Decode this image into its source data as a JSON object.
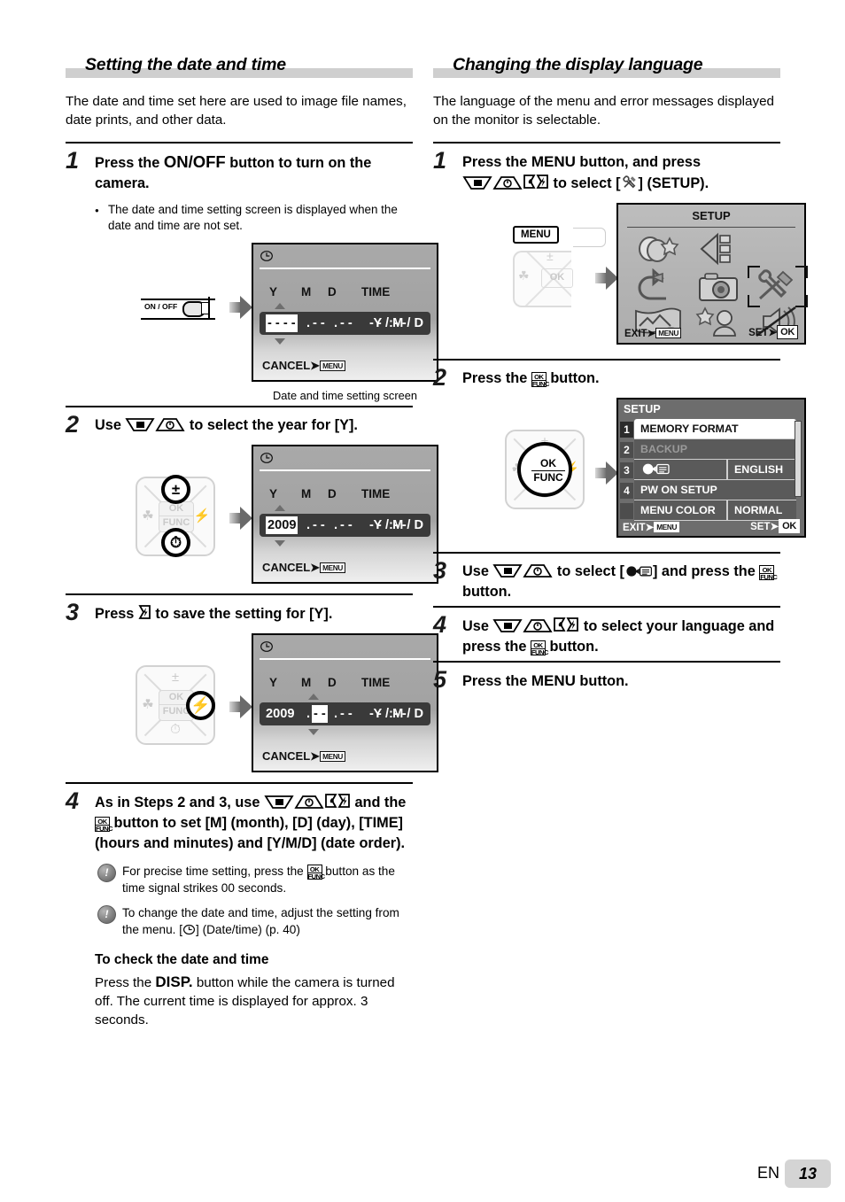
{
  "page": {
    "lang_code": "EN",
    "number": "13"
  },
  "left": {
    "heading": "Setting the date and time",
    "intro": "The date and time set here are used to image file names, date prints, and other data.",
    "step1": {
      "num": "1",
      "head_a": "Press the ",
      "head_btn": "ON/OFF",
      "head_b": " button to turn on the camera.",
      "bullet": "The date and time setting screen is displayed when the date and time are not set.",
      "caption": "Date and time setting screen"
    },
    "step2": {
      "num": "2",
      "head_a": "Use ",
      "head_b": " to select the year for [Y]."
    },
    "step3": {
      "num": "3",
      "head_a": "Press ",
      "head_b": " to save the setting for [Y]."
    },
    "step4": {
      "num": "4",
      "head_a": "As in Steps 2 and 3, use ",
      "head_b": " and the ",
      "head_c": " button to set [M] (month), [D] (day), [TIME] (hours and minutes) and [Y/M/D] (date order).",
      "note1_a": "For precise time setting, press the ",
      "note1_b": " button as the time signal strikes 00 seconds.",
      "note2_a": "To change the date and time, adjust the setting from the menu. [",
      "note2_b": "] (Date/time) (p. 40)",
      "note_icon": "!"
    },
    "check": {
      "heading": "To check the date and time",
      "text_a": "Press the ",
      "btn": "DISP.",
      "text_b": " button while the camera is turned off. The current time is displayed for approx. 3 seconds."
    },
    "lcd1": {
      "clock_icon": "clock-icon",
      "headers": [
        "Y",
        "M",
        "D",
        "TIME"
      ],
      "year": "- - - -",
      "month": "- -",
      "day": "- -",
      "hour": "- -",
      "minute": "- -",
      "order": "Y / M / D",
      "cancel_label": "CANCEL",
      "cancel_key": "MENU",
      "selected_field": "year"
    },
    "lcd2": {
      "headers": [
        "Y",
        "M",
        "D",
        "TIME"
      ],
      "year": "2009",
      "month": "- -",
      "day": "- -",
      "hour": "- -",
      "minute": "- -",
      "order": "Y / M / D",
      "cancel_label": "CANCEL",
      "cancel_key": "MENU",
      "selected_field": "year"
    },
    "lcd3": {
      "headers": [
        "Y",
        "M",
        "D",
        "TIME"
      ],
      "year": "2009",
      "month": "- -",
      "day": "- -",
      "hour": "- -",
      "minute": "- -",
      "order": "Y / M / D",
      "cancel_label": "CANCEL",
      "cancel_key": "MENU",
      "selected_field": "month"
    },
    "onoff_art": {
      "label": "ON / OFF"
    }
  },
  "right": {
    "heading": "Changing the display language",
    "intro": "The language of the menu and error messages displayed on the monitor is selectable.",
    "step1": {
      "num": "1",
      "head_a": "Press the ",
      "head_menu": "MENU",
      "head_b": " button, and press ",
      "head_c": " to select [",
      "head_d": "] (SETUP).",
      "menu_button_label": "MENU"
    },
    "step2": {
      "num": "2",
      "head_a": "Press the ",
      "head_b": " button.",
      "pad_center_top": "OK",
      "pad_center_bottom": "FUNC"
    },
    "step3": {
      "num": "3",
      "head_a": "Use ",
      "head_b": " to select [",
      "head_c": "] and press the ",
      "head_d": " button."
    },
    "step4": {
      "num": "4",
      "head_a": "Use ",
      "head_b": " to select your language and press the ",
      "head_c": " button."
    },
    "step5": {
      "num": "5",
      "head_a": "Press the ",
      "head_menu": "MENU",
      "head_b": " button."
    },
    "setup_grid": {
      "title": "SETUP",
      "exit_label": "EXIT",
      "exit_key": "MENU",
      "set_label": "SET",
      "set_key": "OK",
      "icons": [
        "magic-filter-icon",
        "playback-slideshow-icon",
        "rotate-icon",
        "camera-icon",
        "wrench-tools-setup-icon",
        "panorama-icon",
        "beauty-icon",
        "silent-mute-icon"
      ],
      "selected_icon": "wrench-tools-setup-icon"
    },
    "setup_list": {
      "title": "SETUP",
      "exit_label": "EXIT",
      "exit_key": "MENU",
      "set_label": "SET",
      "set_key": "OK",
      "rows": [
        {
          "index": "1",
          "label": "MEMORY FORMAT",
          "value": "",
          "state": "selected"
        },
        {
          "index": "2",
          "label": "BACKUP",
          "value": "",
          "state": "dim"
        },
        {
          "index": "3",
          "label": "language-icon",
          "value": "ENGLISH",
          "state": "normal"
        },
        {
          "index": "4",
          "label": "PW ON SETUP",
          "value": "",
          "state": "normal"
        },
        {
          "index": "",
          "label": "MENU COLOR",
          "value": "NORMAL",
          "state": "normal"
        }
      ]
    }
  }
}
